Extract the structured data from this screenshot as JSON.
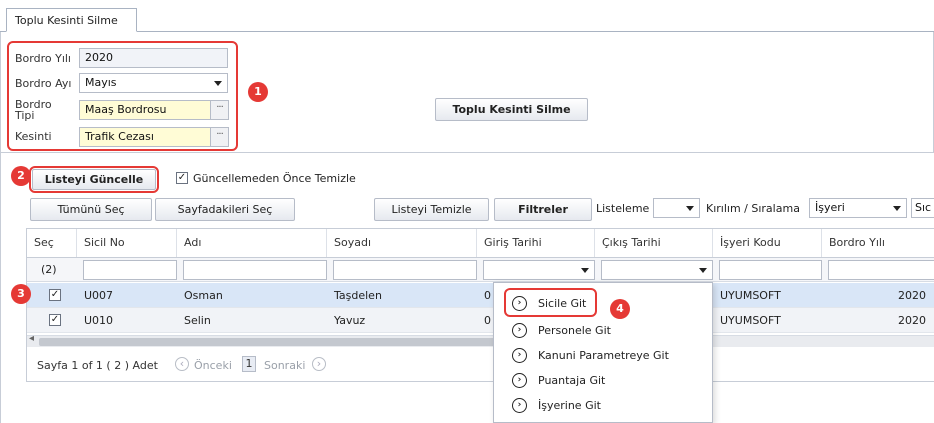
{
  "tab": {
    "label": "Toplu Kesinti Silme"
  },
  "form": {
    "year_label": "Bordro Yılı",
    "year_value": "2020",
    "month_label": "Bordro Ayı",
    "month_value": "Mayıs",
    "type_label_line1": "Bordro",
    "type_label_line2": "Tipi",
    "type_value": "Maaş Bordrosu",
    "deduction_label": "Kesinti",
    "deduction_value": "Trafik Cezası",
    "lookup_glyph": "···"
  },
  "main_action": {
    "label": "Toplu Kesinti Silme"
  },
  "badges": [
    "1",
    "2",
    "3",
    "4"
  ],
  "toolbar": {
    "refresh_label": "Listeyi Güncelle",
    "clear_before_label": "Güncellemeden Önce Temizle",
    "clear_before_checked": "✓",
    "select_all_label": "Tümünü Seç",
    "select_page_label": "Sayfadakileri Seç",
    "clear_list_label": "Listeyi Temizle",
    "filters_label": "Filtreler",
    "listing_label": "Listeleme",
    "sort_label": "Kırılım / Sıralama",
    "sort_value": "İşyeri",
    "cut_label": "Sıc"
  },
  "grid": {
    "columns": [
      "Seç",
      "Sicil No",
      "Adı",
      "Soyadı",
      "Giriş Tarihi",
      "Çıkış Tarihi",
      "İşyeri Kodu",
      "Bordro Yılı"
    ],
    "selected_count": "(2)",
    "rows": [
      {
        "check": "✓",
        "sicil_no": "U007",
        "adi": "Osman",
        "soyadi": "Taşdelen",
        "giris": "0",
        "isyeri": "UYUMSOFT",
        "yil": "2020"
      },
      {
        "check": "✓",
        "sicil_no": "U010",
        "adi": "Selin",
        "soyadi": "Yavuz",
        "giris": "0",
        "isyeri": "UYUMSOFT",
        "yil": "2020"
      }
    ],
    "scroll_left": "◂"
  },
  "pager": {
    "summary": "Sayfa 1 of 1 ( 2 ) Adet",
    "prev_icon": "‹",
    "prev_label": "Önceki",
    "current": "1",
    "next_label": "Sonraki",
    "next_icon": "›"
  },
  "context_menu": {
    "icon_glyph": "›",
    "items": [
      "Sicile Git",
      "Personele Git",
      "Kanuni Parametreye Git",
      "Puantaja Git",
      "İşyerine Git"
    ]
  },
  "colors": {
    "highlight": "#e53935",
    "selected_row": "#d9e6f7",
    "required_field": "#fffcd6"
  }
}
